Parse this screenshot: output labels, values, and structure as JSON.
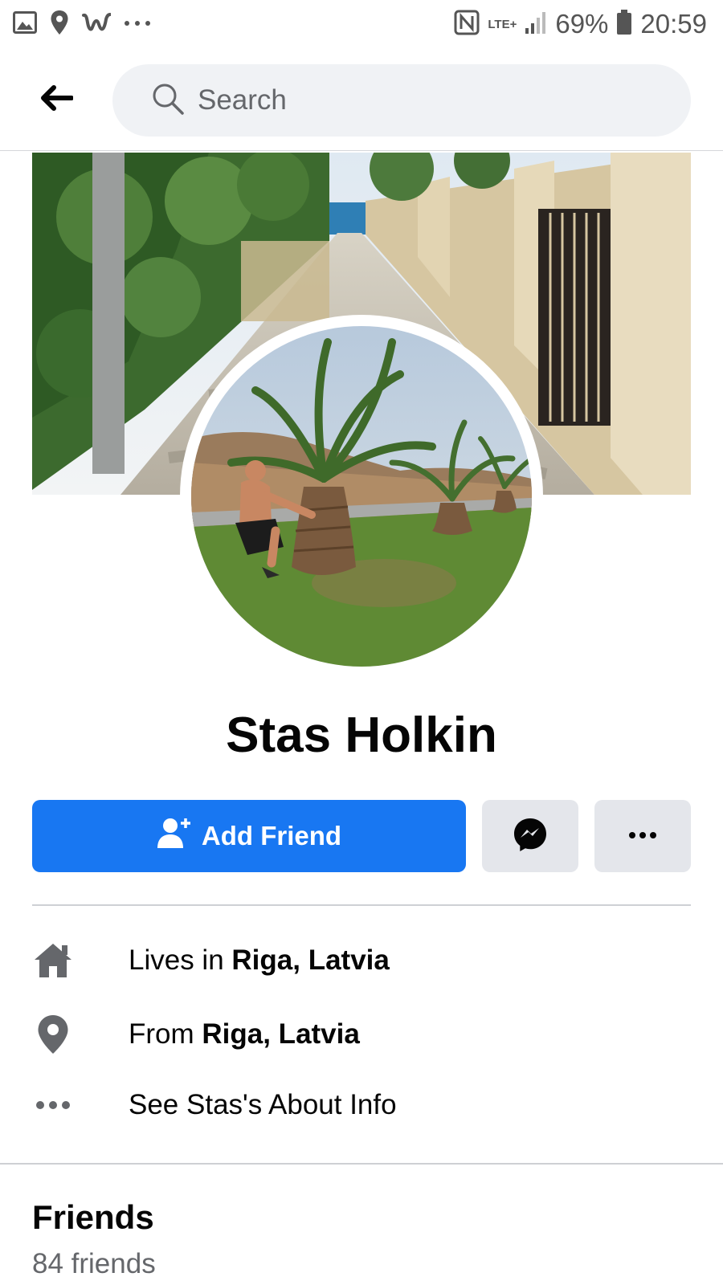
{
  "status_bar": {
    "battery": "69%",
    "time": "20:59",
    "network": "LTE+"
  },
  "header": {
    "search_placeholder": "Search"
  },
  "profile": {
    "name": "Stas Holkin"
  },
  "actions": {
    "add_friend_label": "Add Friend"
  },
  "intro": {
    "lives_prefix": "Lives in ",
    "lives_place": "Riga, Latvia",
    "from_prefix": "From ",
    "from_place": "Riga, Latvia",
    "about_link": "See Stas's About Info"
  },
  "friends": {
    "title": "Friends",
    "count": "84 friends"
  },
  "colors": {
    "brand": "#1877f2",
    "secondary_button": "#e4e6eb",
    "search_bg": "#f0f2f5"
  }
}
